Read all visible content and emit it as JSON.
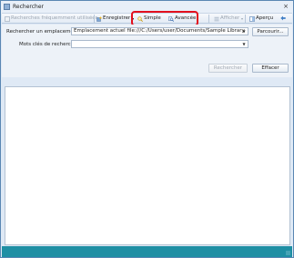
{
  "window": {
    "title": "Rechercher",
    "close_glyph": "×"
  },
  "toolbar": {
    "frequent_label": "Recherches fréquemment utilisées",
    "frequent_arrow": "▾",
    "save_label": "Enregistrer",
    "save_arrow": "▾",
    "simple_label": "Simple",
    "advanced_label": "Avancée",
    "display_label": "Afficher",
    "display_arrow": "▾",
    "preview_label": "Aperçu"
  },
  "search": {
    "location_label": "Rechercher un emplacement :",
    "location_value": "Emplacement actuel file:///C:/Users/user/Documents/Sample Library",
    "browse_label": "Parcourir...",
    "keywords_label": "Mots clés de recherche :",
    "keywords_value": "",
    "search_button": "Rechercher",
    "clear_button": "Effacer"
  },
  "icons": {
    "app": "search-window-icon",
    "frequent": "search-list-icon",
    "save": "save-star-icon",
    "simple": "simple-search-icon",
    "advanced": "advanced-search-icon",
    "display": "display-list-icon",
    "preview": "preview-icon",
    "back": "arrow-left-icon"
  },
  "colors": {
    "highlight": "#e3101d",
    "statusbar": "#1f8fa4",
    "accent": "#3d7cc4"
  }
}
